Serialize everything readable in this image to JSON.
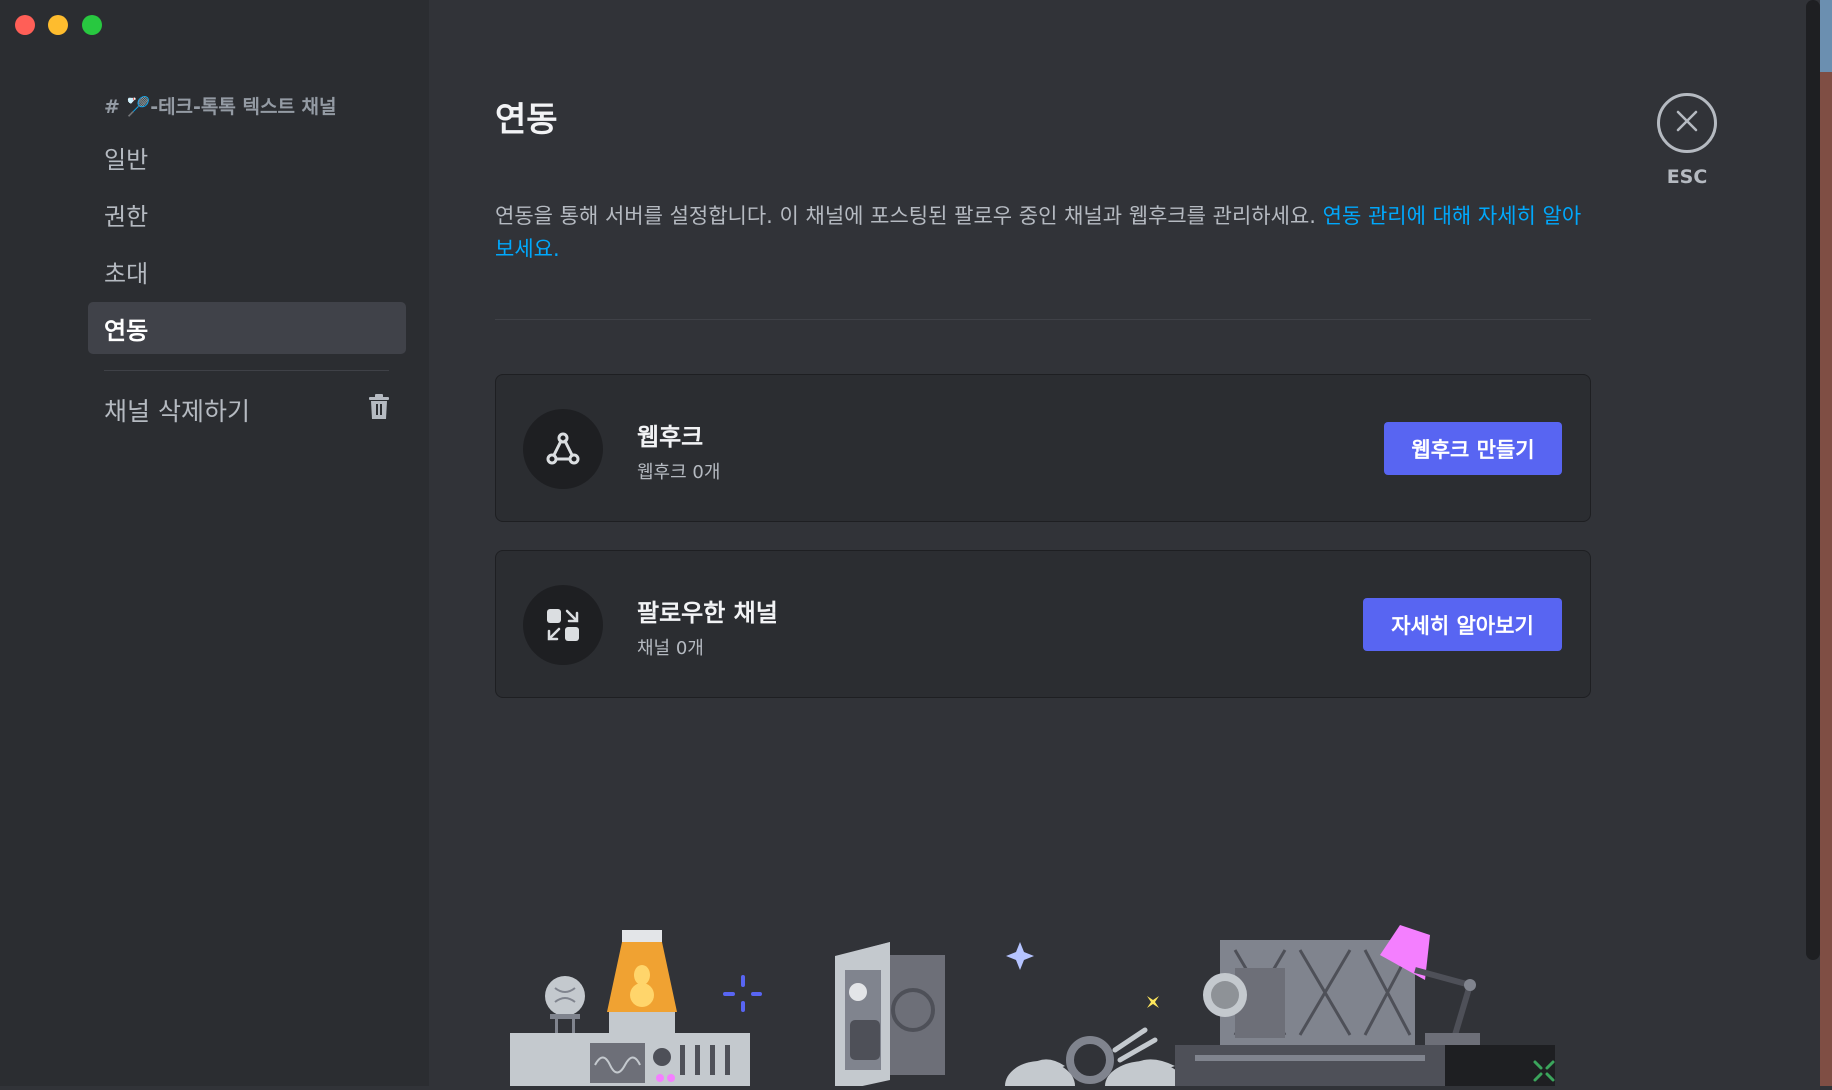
{
  "sidebar": {
    "channel_header": "# 🏸-테크-톡톡 텍스트 채널",
    "items": [
      {
        "label": "일반"
      },
      {
        "label": "권한"
      },
      {
        "label": "초대"
      },
      {
        "label": "연동",
        "active": true
      }
    ],
    "delete_label": "채널 삭제하기"
  },
  "main": {
    "title": "연동",
    "description": "연동을 통해 서버를 설정합니다. 이 채널에 포스팅된 팔로우 중인 채널과 웹후크를 관리하세요. ",
    "learn_more_link": "연동 관리에 대해 자세히 알아보세요.",
    "cards": [
      {
        "title": "웹후크",
        "subtitle": "웹후크 0개",
        "button": "웹후크 만들기",
        "icon": "webhook-icon"
      },
      {
        "title": "팔로우한 채널",
        "subtitle": "채널 0개",
        "button": "자세히 알아보기",
        "icon": "followed-channel-icon"
      }
    ]
  },
  "close": {
    "label": "ESC"
  },
  "colors": {
    "accent": "#5865f2",
    "link": "#00a8fc",
    "bg": "#313338",
    "sidebar": "#2b2d31"
  }
}
